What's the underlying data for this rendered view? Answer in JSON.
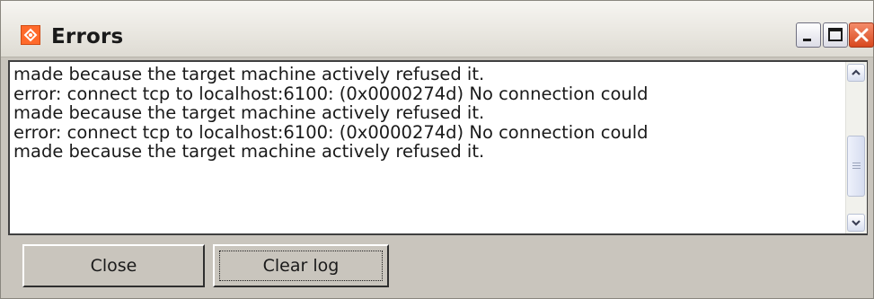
{
  "window": {
    "title": "Errors",
    "app_icon": "app-logo-icon",
    "controls": [
      "minimize-icon",
      "maximize-icon",
      "close-icon"
    ]
  },
  "log": {
    "lines": [
      "made because the target machine actively refused it.",
      "error: connect tcp to localhost:6100: (0x0000274d) No connection could",
      "made because the target machine actively refused it.",
      "error: connect tcp to localhost:6100: (0x0000274d) No connection could",
      "made because the target machine actively refused it."
    ]
  },
  "buttons": {
    "close_label": "Close",
    "clear_label": "Clear log"
  },
  "colors": {
    "app_icon": "#ff6a2b",
    "close_control": "#d8481f",
    "panel": "#c9c5bd"
  }
}
